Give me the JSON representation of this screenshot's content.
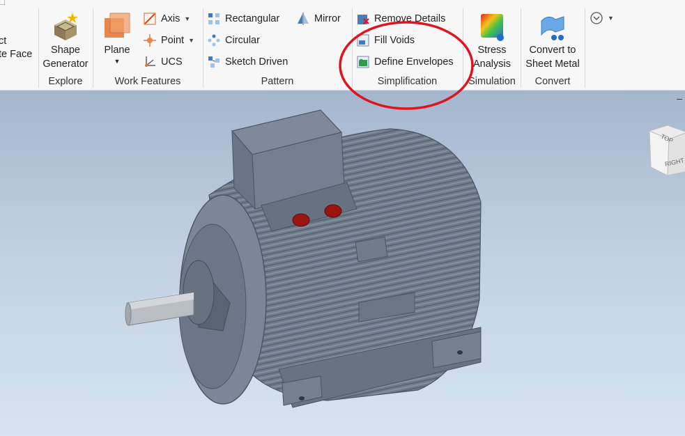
{
  "ribbon": {
    "partial_left": {
      "line1": "ct",
      "line2": "te Face"
    },
    "explore": {
      "shape_generator": {
        "line1": "Shape",
        "line2": "Generator"
      },
      "group_label": "Explore"
    },
    "work_features": {
      "plane_label": "Plane",
      "axis_label": "Axis",
      "point_label": "Point",
      "ucs_label": "UCS",
      "group_label": "Work Features"
    },
    "pattern": {
      "rectangular_label": "Rectangular",
      "circular_label": "Circular",
      "sketch_driven_label": "Sketch Driven",
      "mirror_label": "Mirror",
      "group_label": "Pattern"
    },
    "simplification": {
      "remove_details_label": "Remove Details",
      "fill_voids_label": "Fill Voids",
      "define_envelopes_label": "Define Envelopes",
      "group_label": "Simplification"
    },
    "simulation": {
      "stress_analysis": {
        "line1": "Stress",
        "line2": "Analysis"
      },
      "group_label": "Simulation"
    },
    "convert": {
      "convert_to_sheet_metal": {
        "line1": "Convert to",
        "line2": "Sheet Metal"
      },
      "group_label": "Convert"
    }
  },
  "viewcube": {
    "top_label": "TOP",
    "right_label": "RIGHT"
  },
  "viewport": {
    "minimize_glyph": "–"
  },
  "annotation": {
    "circle_color": "#e0141e"
  }
}
